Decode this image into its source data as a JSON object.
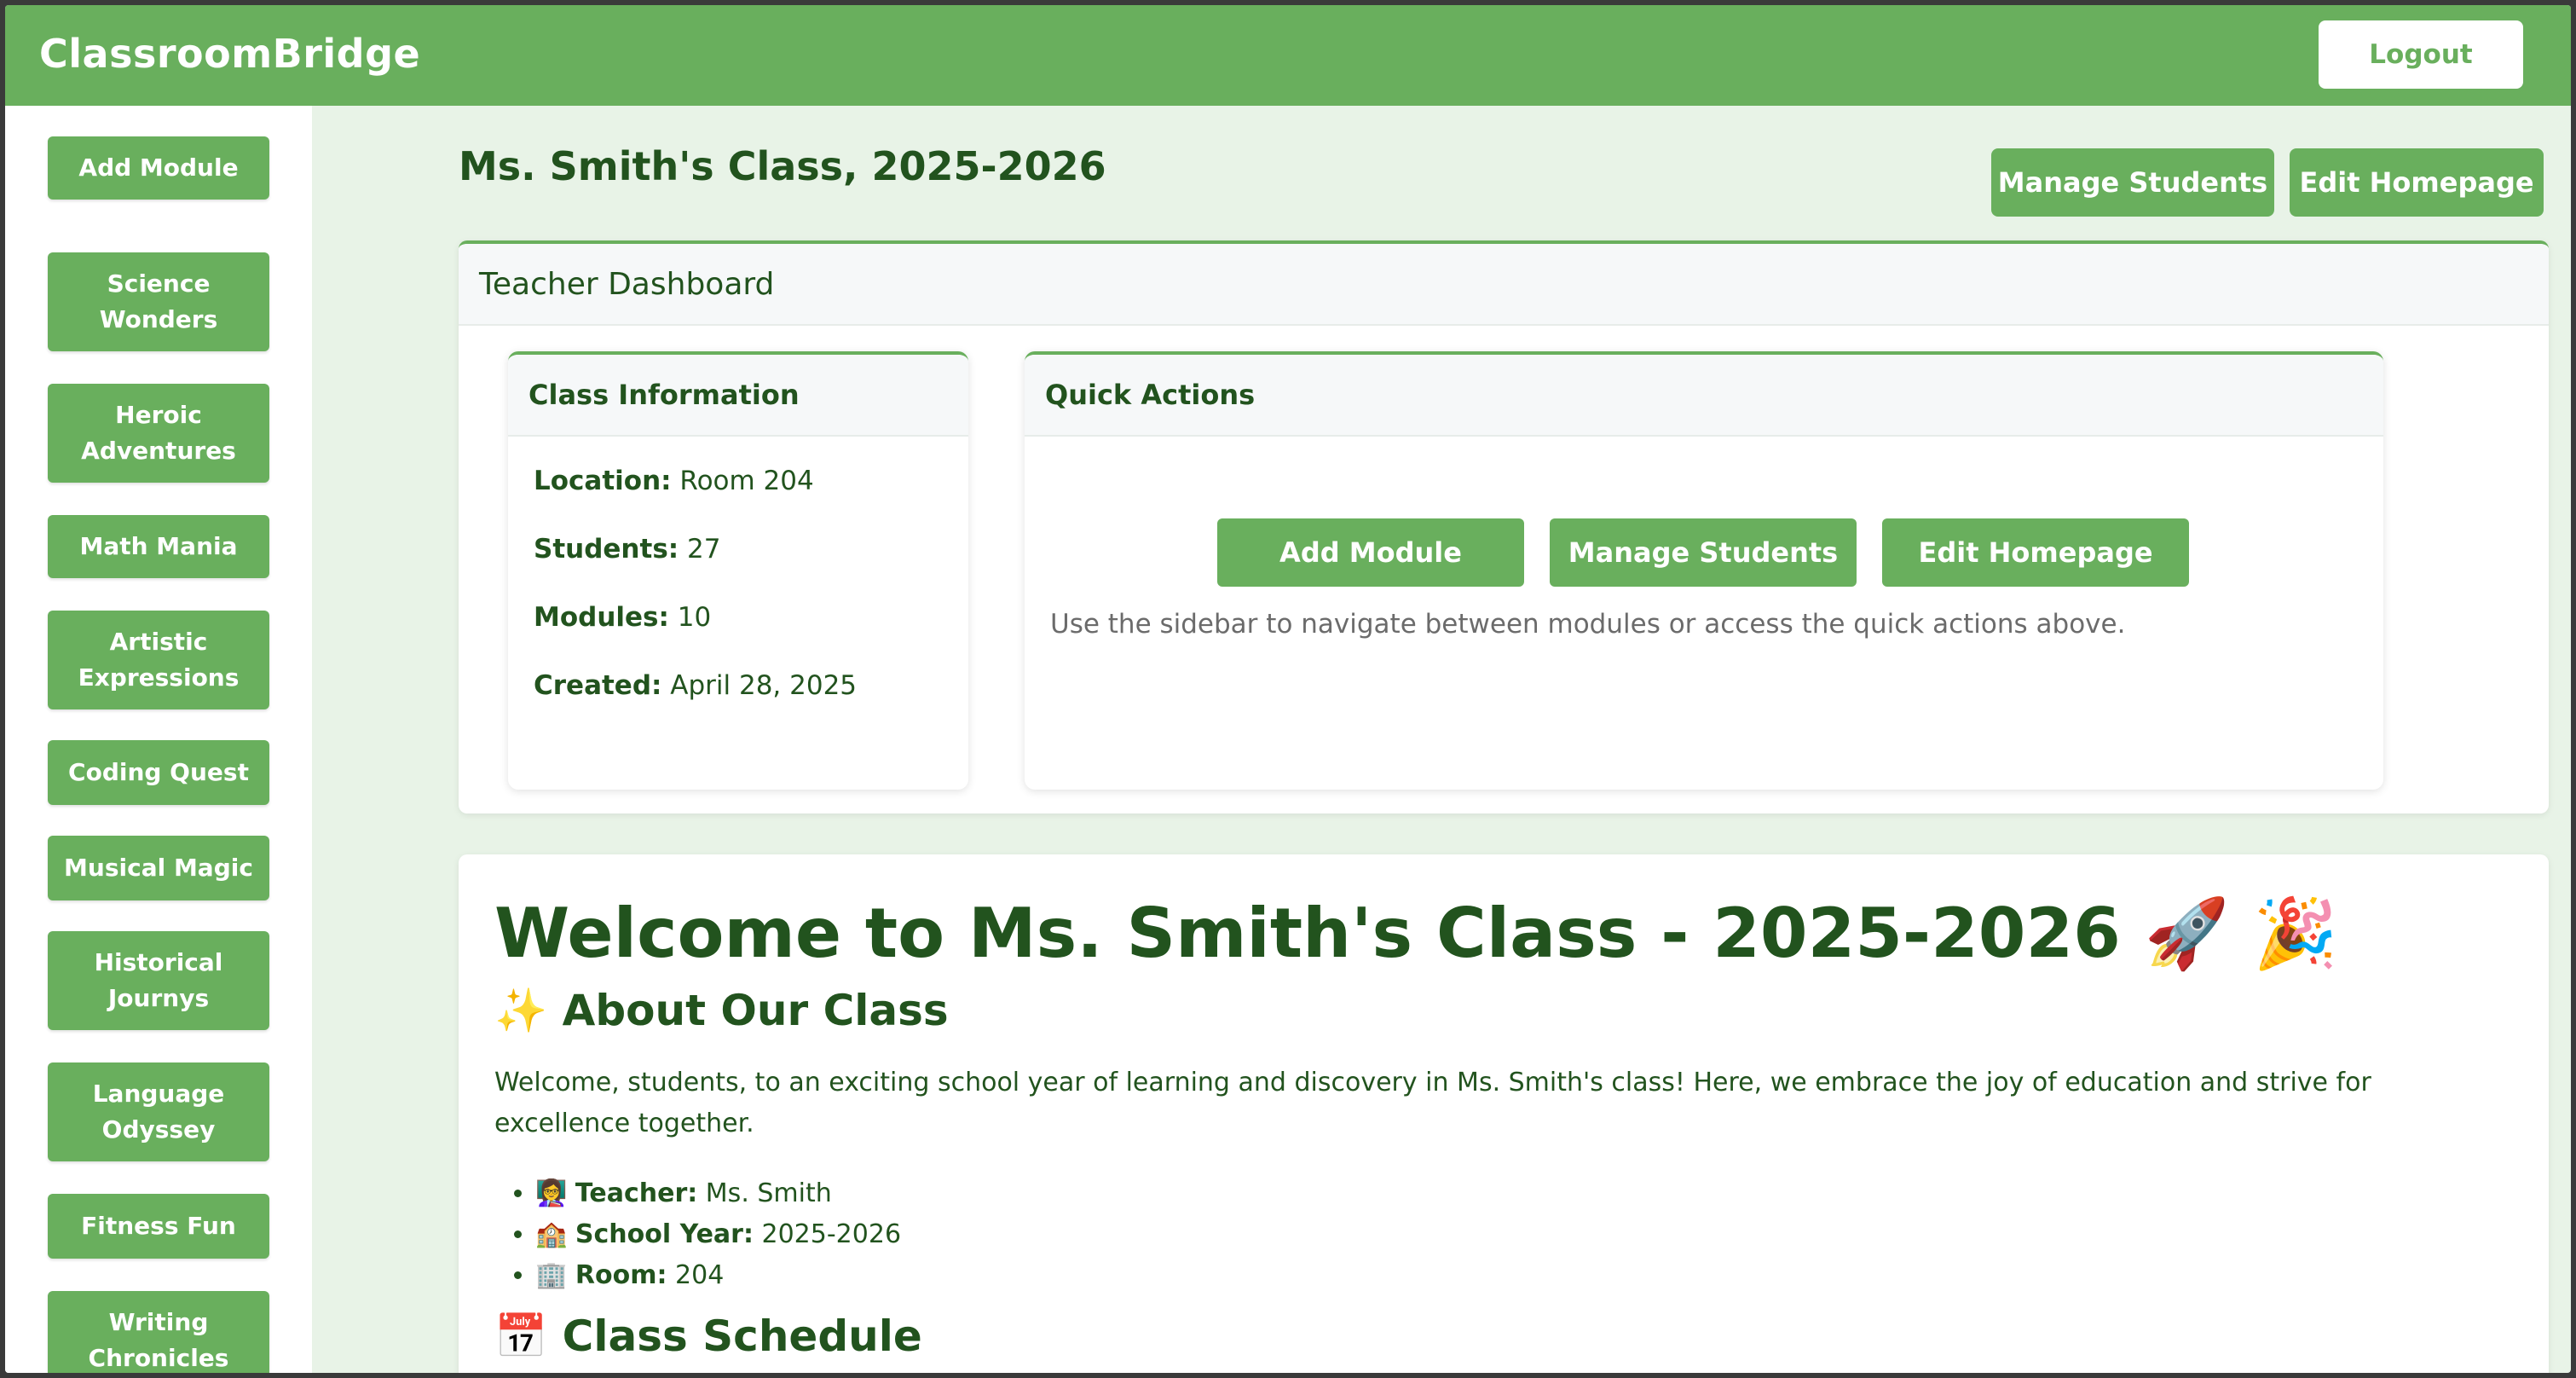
{
  "header": {
    "brand": "ClassroomBridge",
    "logout_label": "Logout"
  },
  "sidebar": {
    "items": [
      {
        "label": "Add Module"
      },
      {
        "label": "Science Wonders"
      },
      {
        "label": "Heroic Adventures"
      },
      {
        "label": "Math Mania"
      },
      {
        "label": "Artistic Expressions"
      },
      {
        "label": "Coding Quest"
      },
      {
        "label": "Musical Magic"
      },
      {
        "label": "Historical Journys"
      },
      {
        "label": "Language Odyssey"
      },
      {
        "label": "Fitness Fun"
      },
      {
        "label": "Writing Chronicles"
      }
    ]
  },
  "page": {
    "title": "Ms. Smith's Class, 2025-2026",
    "manage_students_label": "Manage Students",
    "edit_homepage_label": "Edit Homepage"
  },
  "dashboard": {
    "title": "Teacher Dashboard",
    "class_info": {
      "title": "Class Information",
      "rows": [
        {
          "label": "Location:",
          "value": " Room 204"
        },
        {
          "label": "Students:",
          "value": " 27"
        },
        {
          "label": "Modules:",
          "value": " 10"
        },
        {
          "label": "Created:",
          "value": " April 28, 2025"
        }
      ]
    },
    "quick_actions": {
      "title": "Quick Actions",
      "add_module_label": "Add Module",
      "manage_students_label": "Manage Students",
      "edit_homepage_label": "Edit Homepage",
      "note": "Use the sidebar to navigate between modules or access the quick actions above."
    }
  },
  "welcome": {
    "title": "Welcome to Ms. Smith's Class - 2025-2026 🚀 🎉",
    "about_heading": "✨ About Our Class",
    "about_text": "Welcome, students, to an exciting school year of learning and discovery in Ms. Smith's class! Here, we embrace the joy of education and strive for excellence together.",
    "bullets": [
      {
        "icon": "👩‍🏫",
        "label": "Teacher:",
        "value": " Ms. Smith"
      },
      {
        "icon": "🏫",
        "label": "School Year:",
        "value": " 2025-2026"
      },
      {
        "icon": "🏢",
        "label": "Room:",
        "value": " 204"
      }
    ],
    "schedule_heading": "📅 Class Schedule"
  },
  "colors": {
    "primary": "#69af5d",
    "text_dark": "#22531e",
    "background": "#e8f3e7"
  }
}
